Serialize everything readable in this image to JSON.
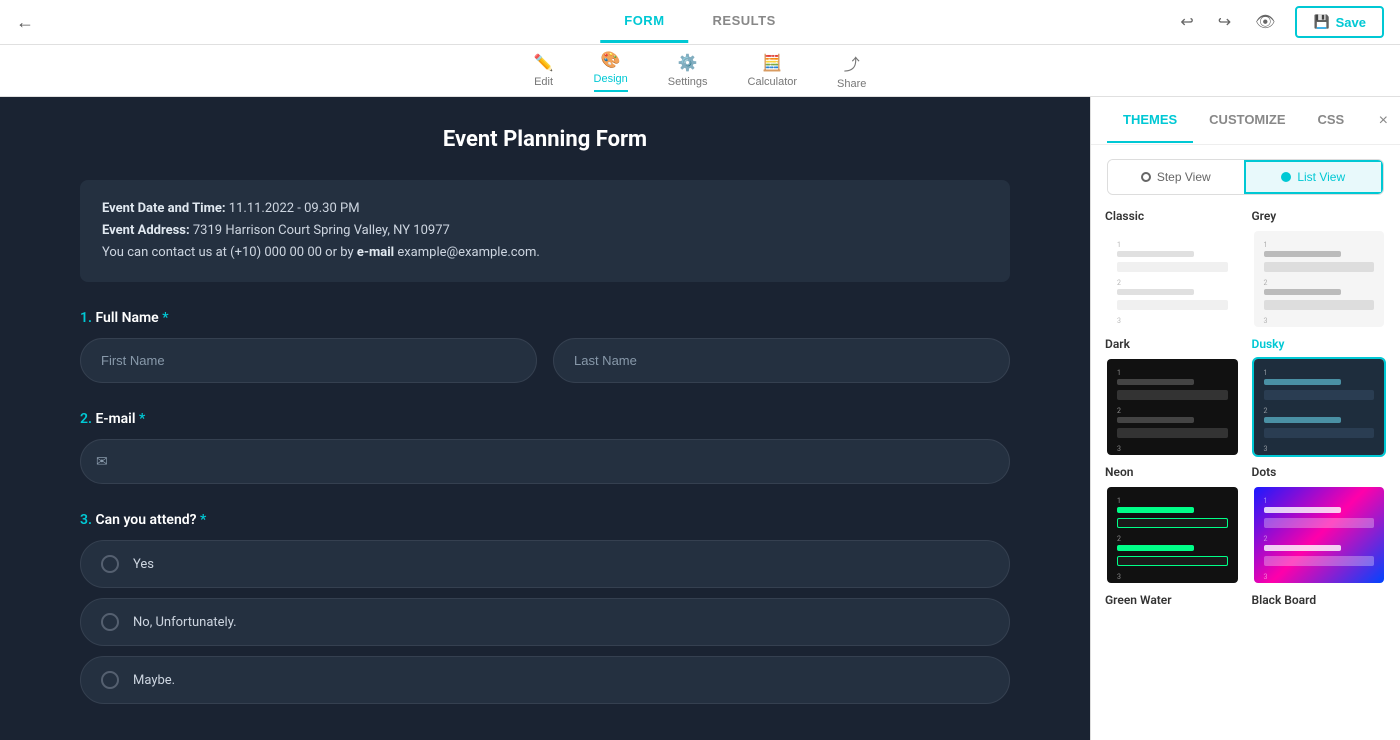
{
  "topNav": {
    "backLabel": "←",
    "tabs": [
      {
        "id": "form",
        "label": "FORM",
        "active": true
      },
      {
        "id": "results",
        "label": "RESULTS",
        "active": false
      }
    ],
    "saveLabel": "Save",
    "undoIcon": "undo",
    "redoIcon": "redo",
    "previewIcon": "eye"
  },
  "toolbar": {
    "items": [
      {
        "id": "edit",
        "label": "Edit",
        "icon": "✏️"
      },
      {
        "id": "design",
        "label": "Design",
        "icon": "🎨",
        "active": true
      },
      {
        "id": "settings",
        "label": "Settings",
        "icon": "⚙️"
      },
      {
        "id": "calculator",
        "label": "Calculator",
        "icon": "🧮"
      },
      {
        "id": "share",
        "label": "Share",
        "icon": "⤴"
      }
    ]
  },
  "formArea": {
    "title": "Event Planning Form",
    "infoBox": {
      "dateLabel": "Event Date and Time:",
      "dateValue": "11.11.2022 - 09.30 PM",
      "addressLabel": "Event Address:",
      "addressValue": "7319 Harrison Court Spring Valley, NY 10977",
      "contactLabel": "You can contact us at",
      "contactPhone": "(+10) 000 00 00",
      "contactOr": "or by",
      "contactEmailLabel": "e-mail",
      "contactEmail": "example@example.com."
    },
    "fields": [
      {
        "id": "full-name",
        "number": "1.",
        "label": "Full Name",
        "required": true,
        "type": "name-split",
        "placeholder1": "First Name",
        "placeholder2": "Last Name"
      },
      {
        "id": "email",
        "number": "2.",
        "label": "E-mail",
        "required": true,
        "type": "email",
        "placeholder": ""
      },
      {
        "id": "attend",
        "number": "3.",
        "label": "Can you attend?",
        "required": true,
        "type": "radio",
        "options": [
          "Yes",
          "No, Unfortunately.",
          "Maybe."
        ]
      }
    ]
  },
  "rightPanel": {
    "tabs": [
      {
        "id": "themes",
        "label": "THEMES",
        "active": true
      },
      {
        "id": "customize",
        "label": "CUSTOMIZE",
        "active": false
      },
      {
        "id": "css",
        "label": "CSS",
        "active": false
      }
    ],
    "closeIcon": "×",
    "viewToggle": {
      "stepView": "Step View",
      "listView": "List View",
      "activeView": "listView"
    },
    "themes": [
      {
        "id": "classic",
        "label": "Classic",
        "style": "classic",
        "active": false
      },
      {
        "id": "grey",
        "label": "Grey",
        "style": "grey",
        "active": false
      },
      {
        "id": "dark",
        "label": "Dark",
        "style": "dark",
        "active": false
      },
      {
        "id": "dusky",
        "label": "Dusky",
        "style": "dusky",
        "active": true
      },
      {
        "id": "neon",
        "label": "Neon",
        "style": "neon",
        "active": false
      },
      {
        "id": "dots",
        "label": "Dots",
        "style": "dots",
        "active": false
      },
      {
        "id": "greenwater",
        "label": "Green Water",
        "style": "greenwater",
        "active": false
      },
      {
        "id": "blackboard",
        "label": "Black Board",
        "style": "blackboard",
        "active": false
      }
    ]
  },
  "colors": {
    "accent": "#00c8d4",
    "formBg": "#1a2332",
    "panelBg": "#ffffff"
  }
}
